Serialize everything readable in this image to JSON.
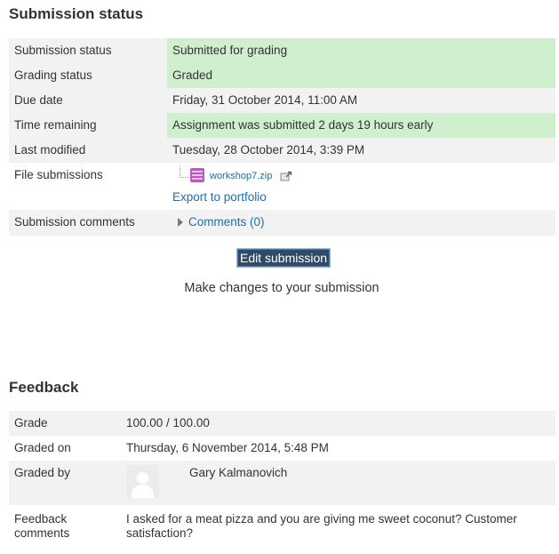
{
  "submission": {
    "heading": "Submission status",
    "rows": {
      "status": {
        "label": "Submission status",
        "value": "Submitted for grading"
      },
      "grading": {
        "label": "Grading status",
        "value": "Graded"
      },
      "due": {
        "label": "Due date",
        "value": "Friday, 31 October 2014, 11:00 AM"
      },
      "remaining": {
        "label": "Time remaining",
        "value": "Assignment was submitted 2 days 19 hours early"
      },
      "modified": {
        "label": "Last modified",
        "value": "Tuesday, 28 October 2014, 3:39 PM"
      },
      "files": {
        "label": "File submissions",
        "file_name": "workshop7.zip",
        "export_label": "Export to portfolio"
      },
      "comments": {
        "label": "Submission comments",
        "toggle_label": "Comments (0)"
      }
    },
    "edit_button_label": "Edit submission",
    "edit_description": "Make changes to your submission",
    "highlight_color": "#cfefcf",
    "link_color": "#1a6fb3"
  },
  "feedback": {
    "heading": "Feedback",
    "rows": {
      "grade": {
        "label": "Grade",
        "value": "100.00 / 100.00"
      },
      "graded_on": {
        "label": "Graded on",
        "value": "Thursday, 6 November 2014, 5:48 PM"
      },
      "graded_by": {
        "label": "Graded by",
        "grader_name": "Gary Kalmanovich",
        "avatar_icon": "default-user-avatar-icon"
      },
      "comments": {
        "label_line1": "Feedback",
        "label_line2": "comments",
        "value": "I asked for a meat pizza and you are giving me sweet coconut? Customer satisfaction?"
      }
    }
  }
}
